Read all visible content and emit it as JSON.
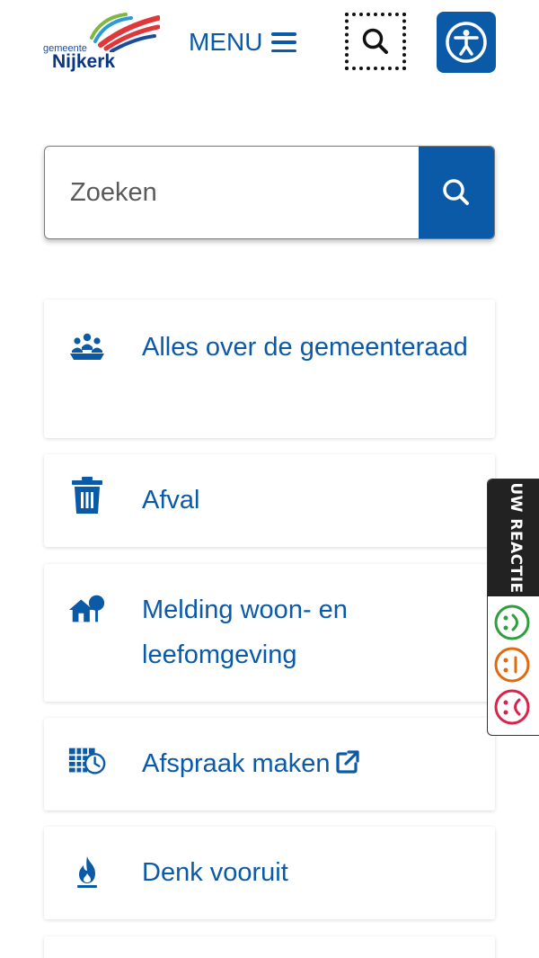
{
  "header": {
    "logo_small_text": "gemeente",
    "logo_big_text": "Nijkerk",
    "menu_label": "MENU",
    "icons": [
      "hamburger-icon",
      "search-icon",
      "accessibility-icon"
    ]
  },
  "search": {
    "placeholder": "Zoeken",
    "icon": "search-icon"
  },
  "cards": [
    {
      "label": "Alles over de gemeenteraad",
      "icon": "people-group-icon"
    },
    {
      "label": "Afval",
      "icon": "trash-icon"
    },
    {
      "label": "Melding woon- en leefomgeving",
      "icon": "house-tree-icon"
    },
    {
      "label": "Afspraak maken",
      "icon": "calendar-clock-icon",
      "external": true,
      "external_icon": "external-link-icon"
    },
    {
      "label": "Denk vooruit",
      "icon": "fire-icon"
    }
  ],
  "feedback": {
    "title": "UW REACTIE",
    "options": [
      {
        "mood": "happy",
        "color": "#2e9e3e"
      },
      {
        "mood": "neutral",
        "color": "#e06a12"
      },
      {
        "mood": "sad",
        "color": "#d8234a"
      }
    ]
  },
  "colors": {
    "primary": "#0a5aa8",
    "logo_navy": "#0a3580",
    "logo_red": "#e0383a",
    "logo_green": "#7fb740"
  }
}
